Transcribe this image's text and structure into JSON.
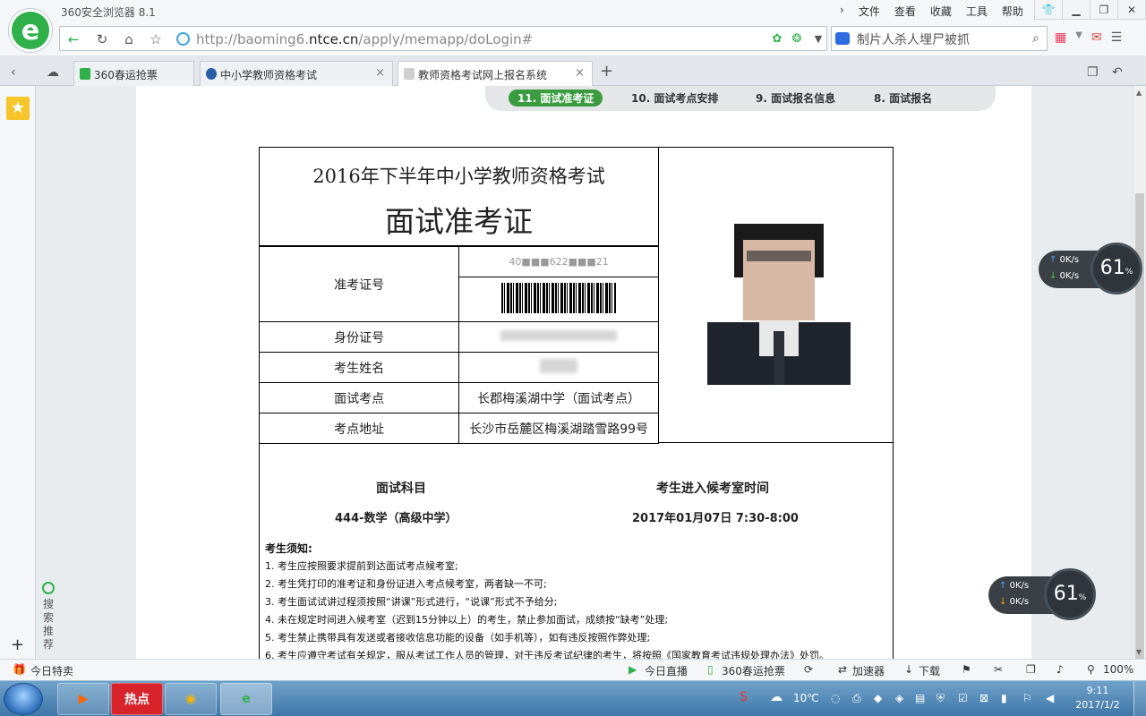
{
  "browser": {
    "title": "360安全浏览器 8.1",
    "menu": [
      "文件",
      "查看",
      "收藏",
      "工具",
      "帮助"
    ],
    "url_prefix": "http://baoming6.",
    "url_domain": "ntce.cn",
    "url_path": "/apply/memapp/doLogin#",
    "search_query": "制片人杀人埋尸被抓",
    "tabs": [
      {
        "label": "360春运抢票",
        "color": "#2fb04a"
      },
      {
        "label": "中小学教师资格考试",
        "color": "#2a5ea8"
      },
      {
        "label": "教师资格考试网上报名系统",
        "color": "#888888"
      }
    ]
  },
  "steps": [
    {
      "label": "11. 面试准考证",
      "active": true
    },
    {
      "label": "10. 面试考点安排",
      "active": false
    },
    {
      "label": "9. 面试报名信息",
      "active": false
    },
    {
      "label": "8. 面试报名",
      "active": false
    }
  ],
  "ticket": {
    "title_line1": "2016年下半年中小学教师资格考试",
    "title_line2": "面试准考证",
    "rows": {
      "exam_no_label": "准考证号",
      "exam_no_value": "40■■■622■■■21",
      "id_label": "身份证号",
      "name_label": "考生姓名",
      "site_label": "面试考点",
      "site_value": "长郡梅溪湖中学（面试考点）",
      "address_label": "考点地址",
      "address_value": "长沙市岳麓区梅溪湖踏雪路99号"
    },
    "subject_header": "面试科目",
    "subject_value": "444-数学（高级中学）",
    "time_header": "考生进入候考室时间",
    "time_value": "2017年01月07日 7:30-8:00",
    "notes_title": "考生须知:",
    "notes": [
      "1. 考生应按照要求提前到达面试考点候考室;",
      "2. 考生凭打印的准考证和身份证进入考点候考室，两者缺一不可;",
      "3. 考生面试试讲过程须按照“讲课”形式进行，“说课”形式不予给分;",
      "4. 未在规定时间进入候考室（迟到15分钟以上）的考生，禁止参加面试，成绩按“缺考”处理;",
      "5. 考生禁止携带具有发送或者接收信息功能的设备（如手机等），如有违反按照作弊处理;",
      "6. 考生应遵守考试有关规定，服从考试工作人员的管理，对于违反考试纪律的考生，将按照《国家教育考试违规处理办法》处罚。"
    ]
  },
  "speed_widget_1": {
    "up": "0K/s",
    "down": "0K/s",
    "percent": "61",
    "unit": "%"
  },
  "speed_widget_2": {
    "up": "0K/s",
    "down": "0K/s",
    "percent": "61",
    "unit": "%"
  },
  "sidebar": {
    "search_label": "搜索推荐"
  },
  "statusbar": {
    "left": "今日特卖",
    "live": "今日直播",
    "ticket": "360春运抢票",
    "accel": "加速器",
    "download": "下载",
    "zoom": "100%"
  },
  "taskbar": {
    "hot_label": "热点",
    "weather": "10℃",
    "time": "9:11",
    "date": "2017/1/2"
  }
}
